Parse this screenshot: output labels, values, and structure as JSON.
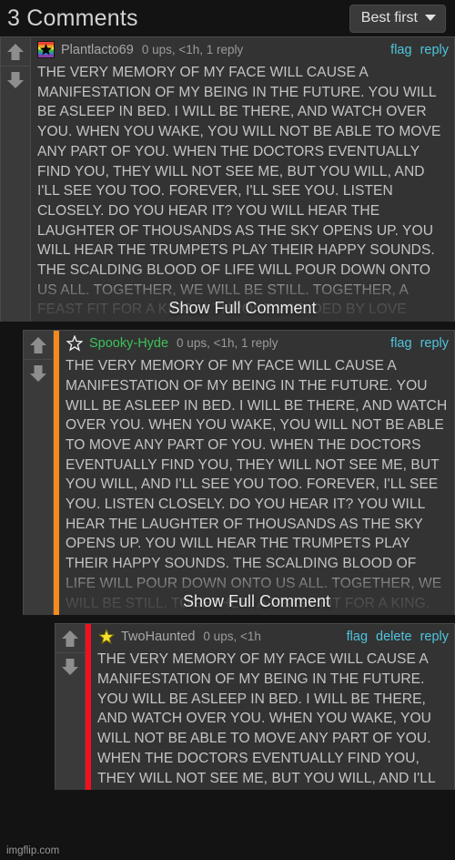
{
  "header": {
    "title": "3 Comments",
    "sort_label": "Best first",
    "sort_icon": "chevron-down-icon"
  },
  "watermark": "imgflip.com",
  "show_full_label": "Show Full Comment",
  "colors": {
    "page_bg": "#131313",
    "comment_bg": "#333333",
    "vote_bg": "#3a3a3a",
    "border": "#4a4a4a",
    "link": "#4fc4dd",
    "text": "#c4c4c4",
    "username_gray": "#a8a8a8",
    "username_green": "#3cc15a",
    "accent_orange": "#f58b1e",
    "accent_red": "#f01020"
  },
  "comments": [
    {
      "id": "comment-1",
      "username": "Plantlacto69",
      "username_color": "gray",
      "avatar": "rainbow-star-avatar",
      "stats": "0 ups, <1h, 1 reply",
      "actions": [
        "flag",
        "reply"
      ],
      "accent": "none",
      "indent": 0,
      "truncated": true,
      "text": "THE VERY MEMORY OF MY FACE WILL CAUSE A MANIFESTATION OF MY BEING IN THE FUTURE. YOU WILL BE ASLEEP IN BED. I WILL BE THERE, AND WATCH OVER YOU. WHEN YOU WAKE, YOU WILL NOT BE ABLE TO MOVE ANY PART OF YOU. WHEN THE DOCTORS EVENTUALLY FIND YOU, THEY WILL NOT SEE ME, BUT YOU WILL, AND I'LL SEE YOU TOO. FOREVER, I'LL SEE YOU. LISTEN CLOSELY. DO YOU HEAR IT? YOU WILL HEAR THE LAUGHTER OF THOUSANDS AS THE SKY OPENS UP. YOU WILL HEAR THE TRUMPETS PLAY THEIR HAPPY SOUNDS. THE SCALDING BLOOD OF LIFE WILL POUR DOWN ONTO US ALL. TOGETHER, WE WILL BE STILL. TOGETHER, A FEAST FIT FOR A KING. A THRONE WIELDED BY LOVE"
    },
    {
      "id": "comment-2",
      "username": "Spooky-Hyde",
      "username_color": "green",
      "avatar": "star-outline-avatar",
      "stats": "0 ups, <1h, 1 reply",
      "actions": [
        "flag",
        "reply"
      ],
      "accent": "orange",
      "indent": 25,
      "truncated": true,
      "text": "THE VERY MEMORY OF MY FACE WILL CAUSE A MANIFESTATION OF MY BEING IN THE FUTURE. YOU WILL BE ASLEEP IN BED. I WILL BE THERE, AND WATCH OVER YOU. WHEN YOU WAKE, YOU WILL NOT BE ABLE TO MOVE ANY PART OF YOU. WHEN THE DOCTORS EVENTUALLY FIND YOU, THEY WILL NOT SEE ME, BUT YOU WILL, AND I'LL SEE YOU TOO. FOREVER, I'LL SEE YOU. LISTEN CLOSELY. DO YOU HEAR IT? YOU WILL HEAR THE LAUGHTER OF THOUSANDS AS THE SKY OPENS UP. YOU WILL HEAR THE TRUMPETS PLAY THEIR HAPPY SOUNDS. THE SCALDING BLOOD OF LIFE WILL POUR DOWN ONTO US ALL. TOGETHER, WE WILL BE STILL. TOGETHER, A FEAST FIT FOR A KING."
    },
    {
      "id": "comment-3",
      "username": "TwoHaunted",
      "username_color": "gray",
      "avatar": "star-yellow-avatar",
      "stats": "0 ups, <1h",
      "actions": [
        "flag",
        "delete",
        "reply"
      ],
      "accent": "red",
      "indent": 60,
      "truncated": false,
      "text": "THE VERY MEMORY OF MY FACE WILL CAUSE A MANIFESTATION OF MY BEING IN THE FUTURE. YOU WILL BE ASLEEP IN BED. I WILL BE THERE, AND WATCH OVER YOU. WHEN YOU WAKE, YOU WILL NOT BE ABLE TO MOVE ANY PART OF YOU. WHEN THE DOCTORS EVENTUALLY FIND YOU, THEY WILL NOT SEE ME, BUT YOU WILL, AND I'LL"
    }
  ]
}
